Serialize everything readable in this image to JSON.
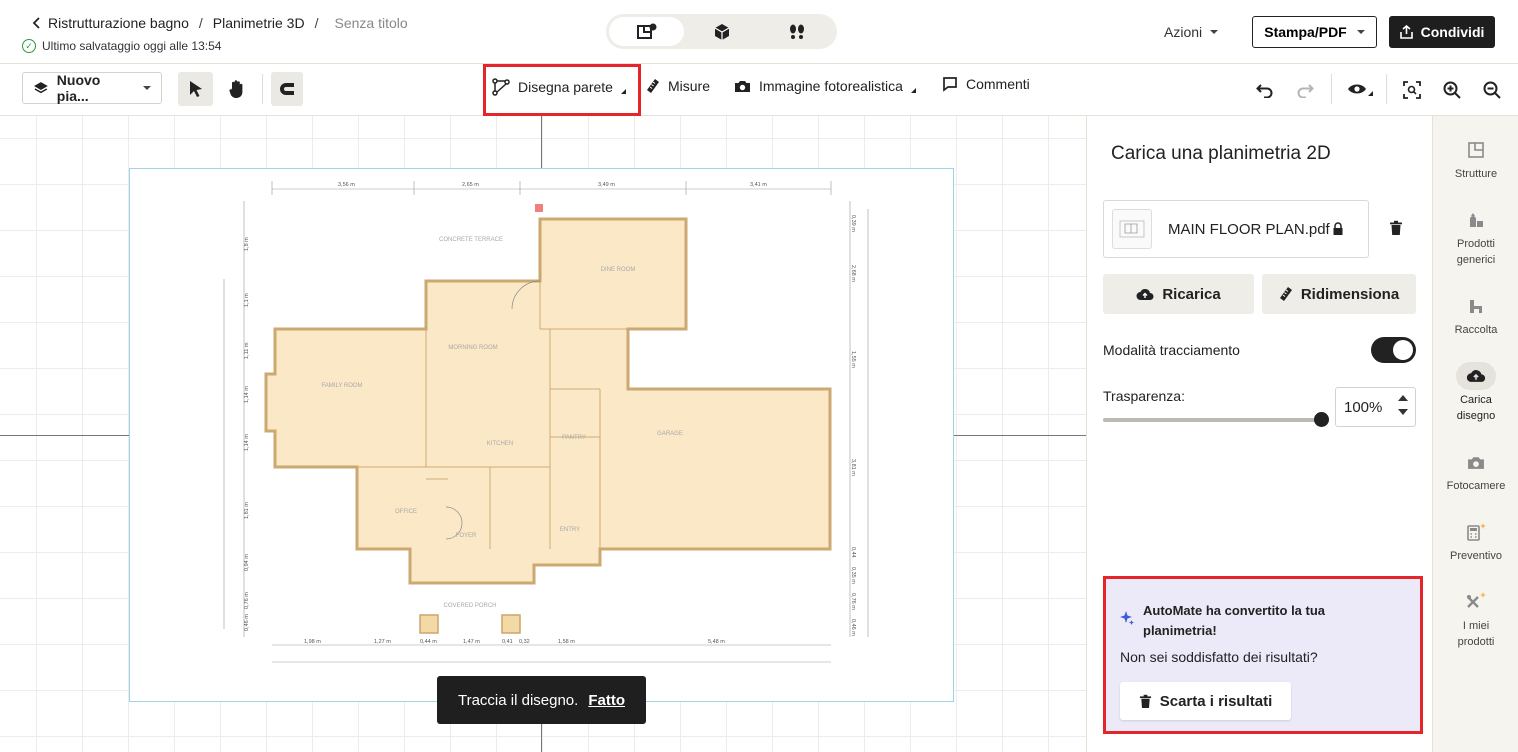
{
  "header": {
    "breadcrumb": [
      "Ristrutturazione bagno",
      "Planimetrie 3D"
    ],
    "breadcrumb_sep": "/",
    "doc_title": "Senza titolo",
    "saved_status": "Ultimo salvataggio oggi alle 13:54",
    "view_modes": [
      "2d-3d-view-icon",
      "3d-box-icon",
      "walk-footsteps-icon"
    ],
    "actions_label": "Azioni",
    "print_label": "Stampa/PDF",
    "share_label": "Condividi"
  },
  "toolbar": {
    "layer_label": "Nuovo pia...",
    "draw_wall_label": "Disegna parete",
    "measures_label": "Misure",
    "photo_label": "Immagine fotorealistica",
    "comments_label": "Commenti"
  },
  "plan": {
    "top_dims": [
      "3,56 m",
      "2,65 m",
      "3,49 m",
      "3,41 m"
    ],
    "bottom_dims": [
      "1,98 m",
      "1,27 m",
      "0,44 m",
      "1,47 m",
      "0,41",
      "0,32",
      "1,58 m",
      "5,48 m"
    ],
    "left_dims": [
      "1,8 m",
      "1,1 m",
      "1,11 m",
      "1,14 m",
      "1,14 m",
      "1,81 m",
      "0,94 m",
      "0,76 m",
      "0,46 m"
    ],
    "right_dims": [
      "0,39 m",
      "2,68 m",
      "1,55 m",
      "3,81 m",
      "0,44",
      "0,35 m",
      "0,76 m",
      "0,46 m"
    ],
    "rooms": [
      "CONCRETE TERRACE",
      "DINE ROOM",
      "MORNING ROOM",
      "FAMILY ROOM",
      "KITCHEN",
      "PANTRY",
      "GARAGE",
      "OFFICE",
      "FOYER",
      "ENTRY",
      "COVERED PORCH"
    ]
  },
  "toast": {
    "text": "Traccia il disegno.",
    "link": "Fatto"
  },
  "panel": {
    "title": "Carica una planimetria 2D",
    "file_name": "MAIN FLOOR PLAN.pdf",
    "reload_label": "Ricarica",
    "resize_label": "Ridimensiona",
    "tracing_label": "Modalità tracciamento",
    "tracing_on": true,
    "transparency_label": "Trasparenza:",
    "transparency_value": "100%",
    "transparency_level": 1.0,
    "automate_title": "AutoMate ha convertito la tua planimetria!",
    "automate_sub": "Non sei soddisfatto dei risultati?",
    "discard_label": "Scarta i risultati"
  },
  "rail": [
    {
      "icon": "structures-icon",
      "label": "Strutture"
    },
    {
      "icon": "generic-products-icon",
      "label": "Prodotti generici"
    },
    {
      "icon": "collection-icon",
      "label": "Raccolta"
    },
    {
      "icon": "upload-cloud-icon",
      "label": "Carica disegno"
    },
    {
      "icon": "camera-icon",
      "label": "Fotocamere"
    },
    {
      "icon": "calculator-icon",
      "label": "Preventivo"
    },
    {
      "icon": "my-products-icon",
      "label": "I miei prodotti"
    }
  ],
  "colors": {
    "accent_red": "#e5252a",
    "room_fill": "#fbe7c4",
    "wall": "#c9a56a",
    "automate_bg": "#ece9f8",
    "dark": "#1e1e1e"
  }
}
